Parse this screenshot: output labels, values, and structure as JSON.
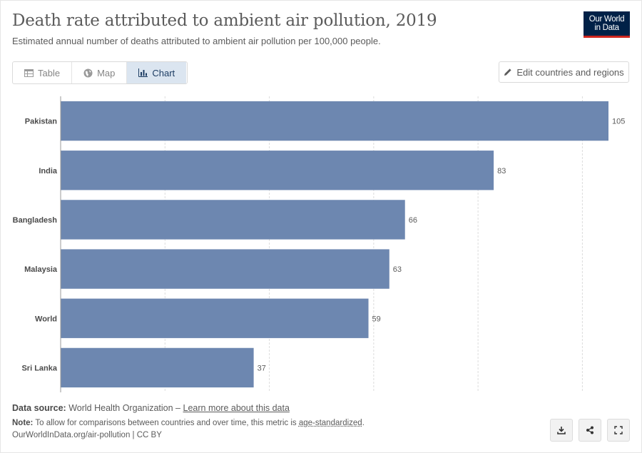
{
  "header": {
    "title": "Death rate attributed to ambient air pollution, 2019",
    "subtitle": "Estimated annual number of deaths attributed to ambient air pollution per 100,000 people.",
    "logo_line1": "Our World",
    "logo_line2": "in Data"
  },
  "tabs": [
    {
      "label": "Table",
      "icon": "table-icon",
      "active": false
    },
    {
      "label": "Map",
      "icon": "globe-icon",
      "active": false
    },
    {
      "label": "Chart",
      "icon": "chart-icon",
      "active": true
    }
  ],
  "edit_button": {
    "label": "Edit countries and regions",
    "icon": "pencil-icon"
  },
  "chart_data": {
    "type": "bar",
    "orientation": "horizontal",
    "categories": [
      "Pakistan",
      "India",
      "Bangladesh",
      "Malaysia",
      "World",
      "Sri Lanka"
    ],
    "values": [
      105,
      83,
      66,
      63,
      59,
      37
    ],
    "value_labels": [
      "105",
      "83",
      "66",
      "63",
      "59",
      "37"
    ],
    "xlim": [
      0,
      105
    ],
    "grid": "vertical-dashed",
    "bar_color": "#6d87b0"
  },
  "footer": {
    "source_label": "Data source:",
    "source_text": "World Health Organization – ",
    "source_link": "Learn more about this data",
    "note_label": "Note:",
    "note_text": "To allow for comparisons between countries and over time, this metric is ",
    "note_link": "age-standardized",
    "note_end": ".",
    "url": "OurWorldInData.org/air-pollution | CC BY"
  },
  "actions": [
    {
      "name": "download-icon"
    },
    {
      "name": "share-icon"
    },
    {
      "name": "fullscreen-icon"
    }
  ]
}
